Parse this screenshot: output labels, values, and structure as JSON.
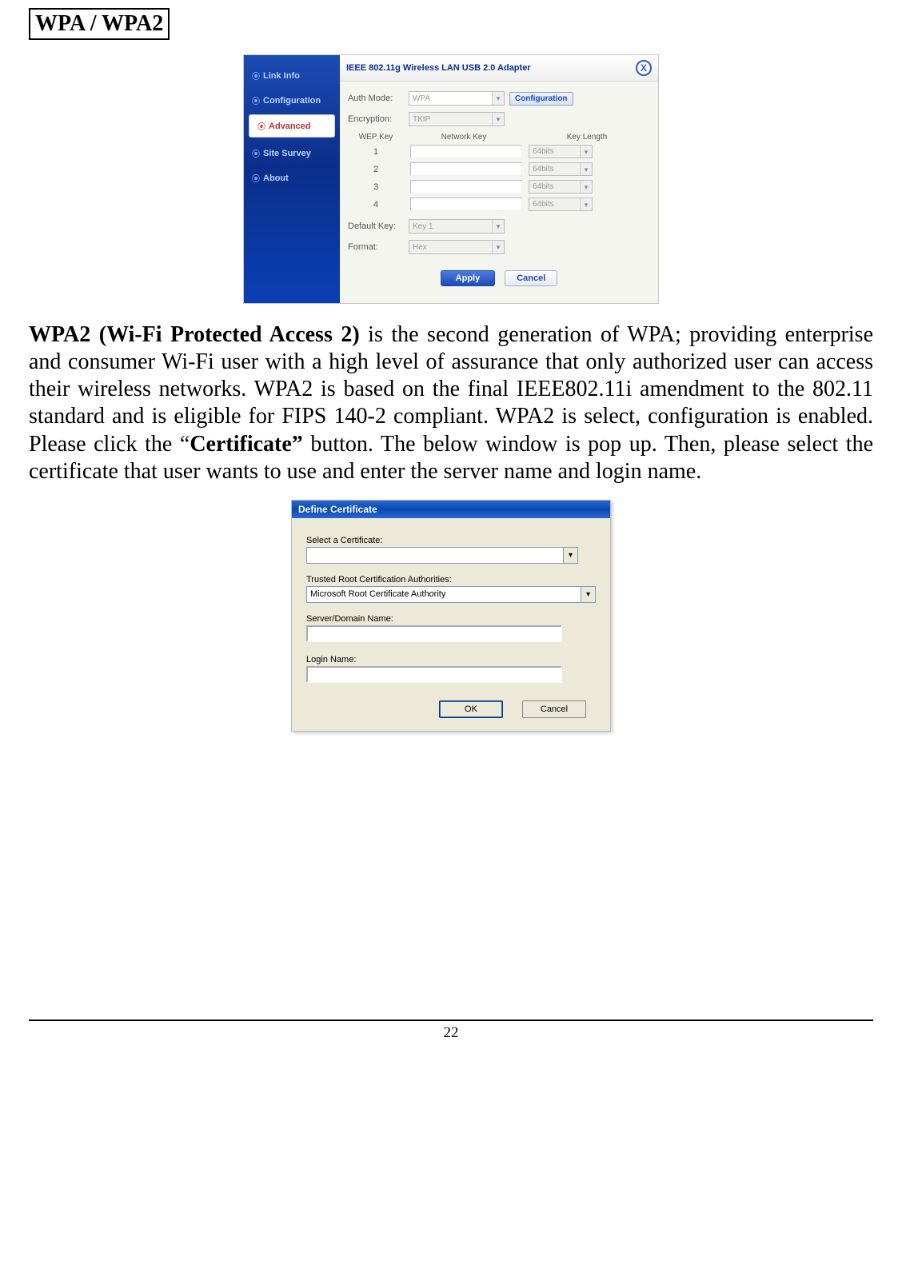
{
  "heading": "WPA / WPA2",
  "paragraph_lead": "WPA2 (Wi-Fi Protected Access 2)",
  "paragraph_rest": " is the second generation of WPA; providing enterprise and consumer Wi-Fi user with a high level of assurance that only authorized user can access their wireless networks. WPA2 is based on the final IEEE802.11i amendment to the 802.11 standard and is eligible for FIPS 140-2 compliant. WPA2 is select, configuration is enabled.  Please click the “",
  "paragraph_cert": "Certificate”",
  "paragraph_tail": " button. The below window is pop up. Then, please select the certificate that user wants to use and enter the server name and login name.",
  "page_number": "22",
  "ss1": {
    "title": "IEEE 802.11g Wireless LAN USB 2.0 Adapter",
    "close": "X",
    "nav": [
      "Link Info",
      "Configuration",
      "Advanced",
      "Site Survey",
      "About"
    ],
    "auth_label": "Auth Mode:",
    "auth_value": "WPA",
    "config_btn": "Configuration",
    "enc_label": "Encryption:",
    "enc_value": "TKIP",
    "col_wep": "WEP Key",
    "col_net": "Network Key",
    "col_len": "Key Length",
    "wep_rows": [
      "1",
      "2",
      "3",
      "4"
    ],
    "len_value": "64bits",
    "def_label": "Default Key:",
    "def_value": "Key 1",
    "fmt_label": "Format:",
    "fmt_value": "Hex",
    "apply": "Apply",
    "cancel": "Cancel"
  },
  "ss2": {
    "title": "Define Certificate",
    "select_label": "Select a Certificate:",
    "select_value": "",
    "trusted_label": "Trusted Root Certification Authorities:",
    "trusted_value": "Microsoft Root Certificate Authority",
    "server_label": "Server/Domain Name:",
    "login_label": "Login Name:",
    "ok": "OK",
    "cancel": "Cancel"
  }
}
